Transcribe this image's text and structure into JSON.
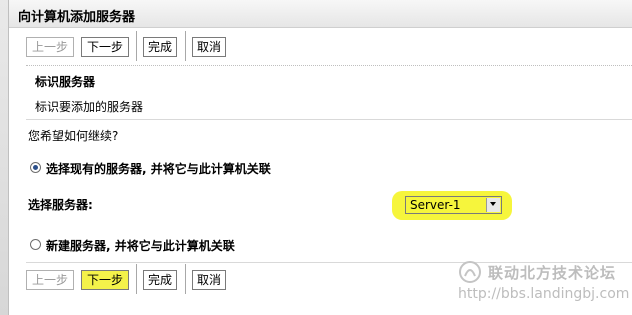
{
  "window": {
    "title": "向计算机添加服务器"
  },
  "toolbar": {
    "back_label": "上一步",
    "next_label": "下一步",
    "finish_label": "完成",
    "cancel_label": "取消"
  },
  "section": {
    "heading": "标识服务器",
    "description": "标识要添加的服务器"
  },
  "question": "您希望如何继续?",
  "options": {
    "existing": {
      "label": "选择现有的服务器, 并将它与此计算机关联",
      "selected": true
    },
    "new": {
      "label": "新建服务器, 并将它与此计算机关联",
      "selected": false
    }
  },
  "server_select": {
    "label": "选择服务器:",
    "value": "Server-1"
  },
  "watermark": {
    "brand": "联动北方技术论坛",
    "url": "http://bbs.landingbj.com"
  },
  "colors": {
    "highlight": "#f6f53c",
    "radio_dot": "#2b4f8a"
  },
  "icons": {
    "dropdown": "chevron-down-icon",
    "logo": "brand-logo-icon"
  }
}
